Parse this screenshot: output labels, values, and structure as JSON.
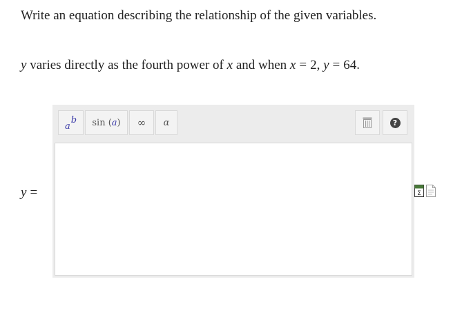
{
  "question": {
    "instruction": "Write an equation describing the relationship of the given variables.",
    "problem": {
      "var_y": "y",
      "text_1": " varies directly as the fourth power of ",
      "var_x": "x",
      "text_2": " and when ",
      "cond_x_var": "x",
      "equals_1": "=",
      "cond_x_val": "2,",
      "cond_y_var": "y",
      "equals_2": "=",
      "cond_y_val": "64."
    },
    "answer_label_var": "y",
    "answer_label_equals": "="
  },
  "editor": {
    "toolbar": {
      "power_base": "a",
      "power_exp": "b",
      "trig_func": "sin",
      "trig_arg": "a",
      "infinity": "∞",
      "alpha": "α",
      "trash_icon": "trash-icon",
      "help_symbol": "?"
    },
    "input_value": ""
  },
  "side_icons": [
    "math-editor-icon",
    "text-editor-icon"
  ]
}
